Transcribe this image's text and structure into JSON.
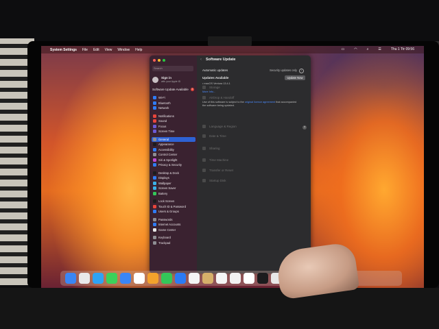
{
  "menubar": {
    "app_name": "System Settings",
    "menus": [
      "File",
      "Edit",
      "View",
      "Window",
      "Help"
    ],
    "clock": "Thu 1 Ttr 09:56"
  },
  "window": {
    "traffic_lights": [
      "#ff5f57",
      "#febc2e",
      "#28c840"
    ],
    "search_placeholder": "Search",
    "account": {
      "title": "Sign in",
      "subtitle": "with your Apple ID"
    },
    "software_update_label": "Software Update Available",
    "badge_count": "1",
    "sidebar_items": [
      {
        "label": "Wi-Fi",
        "color": "#2f7cf6"
      },
      {
        "label": "Bluetooth",
        "color": "#2f7cf6"
      },
      {
        "label": "Network",
        "color": "#2f7cf6"
      },
      {
        "label": "Notifications",
        "color": "#e8453c"
      },
      {
        "label": "Sound",
        "color": "#e8453c"
      },
      {
        "label": "Focus",
        "color": "#6b5ad6"
      },
      {
        "label": "Screen Time",
        "color": "#6b5ad6"
      },
      {
        "label": "General",
        "color": "#8e8e93",
        "selected": true
      },
      {
        "label": "Appearance",
        "color": "#1c1c1e"
      },
      {
        "label": "Accessibility",
        "color": "#2f7cf6"
      },
      {
        "label": "Control Center",
        "color": "#8e8e93"
      },
      {
        "label": "Siri & Spotlight",
        "color": "#c04ad0"
      },
      {
        "label": "Privacy & Security",
        "color": "#2f7cf6"
      },
      {
        "label": "Desktop & Dock",
        "color": "#1c1c1e"
      },
      {
        "label": "Displays",
        "color": "#2f7cf6"
      },
      {
        "label": "Wallpaper",
        "color": "#3ab0e8"
      },
      {
        "label": "Screen Saver",
        "color": "#3ab0e8"
      },
      {
        "label": "Battery",
        "color": "#34c759"
      },
      {
        "label": "Lock Screen",
        "color": "#1c1c1e"
      },
      {
        "label": "Touch ID & Password",
        "color": "#e8453c"
      },
      {
        "label": "Users & Groups",
        "color": "#2f7cf6"
      },
      {
        "label": "Passwords",
        "color": "#8e8e93"
      },
      {
        "label": "Internet Accounts",
        "color": "#2f7cf6"
      },
      {
        "label": "Game Center",
        "color": "#e8e8e8"
      },
      {
        "label": "Keyboard",
        "color": "#8e8e93"
      },
      {
        "label": "Trackpad",
        "color": "#8e8e93"
      }
    ]
  },
  "main": {
    "title": "Software Update",
    "automatic_updates_label": "Automatic updates",
    "automatic_updates_value": "Security updates only",
    "updates_available_label": "Updates Available",
    "update_now_button": "Update Now",
    "update_item": "• macOS Ventura 13.4.1",
    "more_info": "More Info...",
    "license_prefix": "Use of this software is subject to the",
    "license_link": "original licence agreement",
    "license_suffix": "that accompanied the software being updated.",
    "dim_items": [
      "AirDrop & Handoff",
      "Language & Region",
      "Date & Time",
      "Sharing",
      "Time Machine",
      "Transfer or Reset",
      "Startup Disk"
    ],
    "dim_item_above": "Storage"
  },
  "dock": {
    "icon_colors": [
      "#3a86f5",
      "#e9e9ea",
      "#2fa3f5",
      "#3bd15a",
      "#3a86f5",
      "#ffffff",
      "#f3a22c",
      "#34c759",
      "#2b7bf5",
      "#f4f4f4",
      "#d6b06a",
      "#f5f5f5",
      "#f2f2f2",
      "#ffffff",
      "#1c1c1e",
      "#e8e8e8",
      "#6a7bd6",
      "#5aa8e6",
      "#9a9a9a"
    ]
  }
}
